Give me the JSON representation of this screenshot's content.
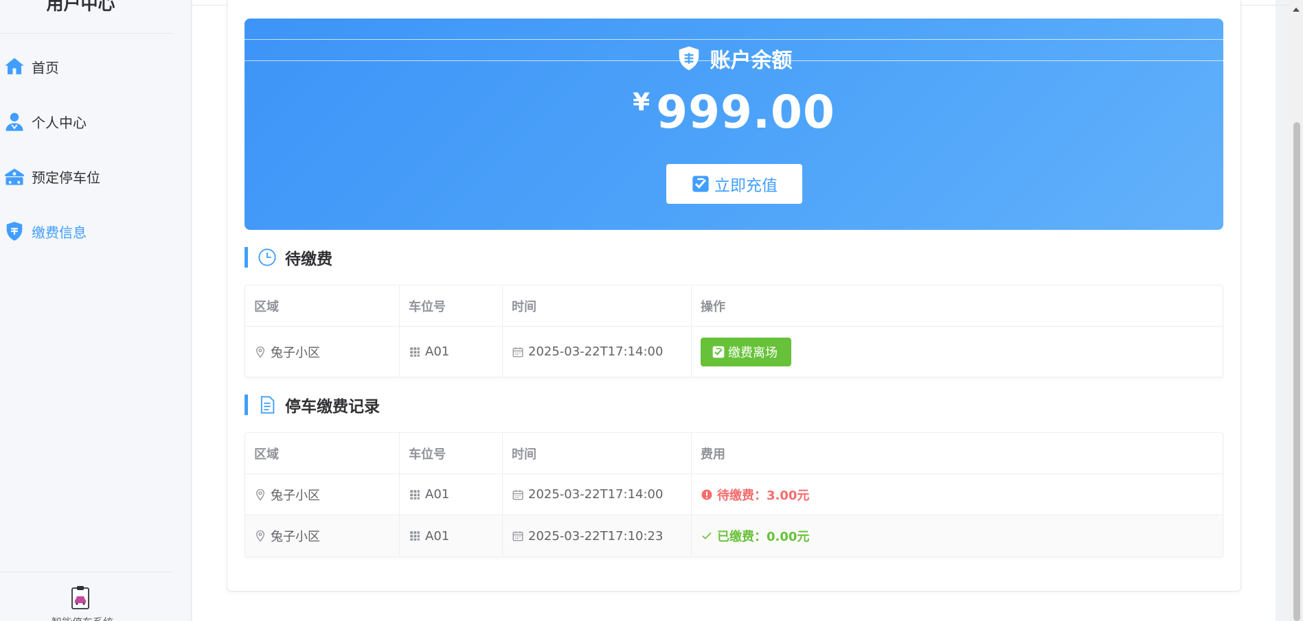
{
  "sidebar": {
    "title": "用户中心",
    "items": [
      {
        "label": "首页",
        "icon": "home-icon"
      },
      {
        "label": "个人中心",
        "icon": "user-icon"
      },
      {
        "label": "预定停车位",
        "icon": "parking-icon"
      },
      {
        "label": "缴费信息",
        "icon": "payment-shield-icon",
        "active": true
      }
    ],
    "footer_text": "智能停车系统"
  },
  "balance": {
    "title": "账户余额",
    "currency": "¥",
    "amount": "999.00",
    "recharge_label": "立即充值"
  },
  "pending": {
    "title": "待缴费",
    "headers": [
      "区域",
      "车位号",
      "时间",
      "操作"
    ],
    "rows": [
      {
        "area": "兔子小区",
        "space": "A01",
        "time": "2025-03-22T17:14:00",
        "action": "缴费离场"
      }
    ]
  },
  "records": {
    "title": "停车缴费记录",
    "headers": [
      "区域",
      "车位号",
      "时间",
      "费用"
    ],
    "rows": [
      {
        "area": "兔子小区",
        "space": "A01",
        "time": "2025-03-22T17:14:00",
        "fee": "待缴费：3.00元",
        "status": "unpaid"
      },
      {
        "area": "兔子小区",
        "space": "A01",
        "time": "2025-03-22T17:10:23",
        "fee": "已缴费：0.00元",
        "status": "paid"
      }
    ]
  },
  "colors": {
    "accent": "#409eff",
    "success": "#67c23a",
    "danger": "#f56c6c"
  }
}
